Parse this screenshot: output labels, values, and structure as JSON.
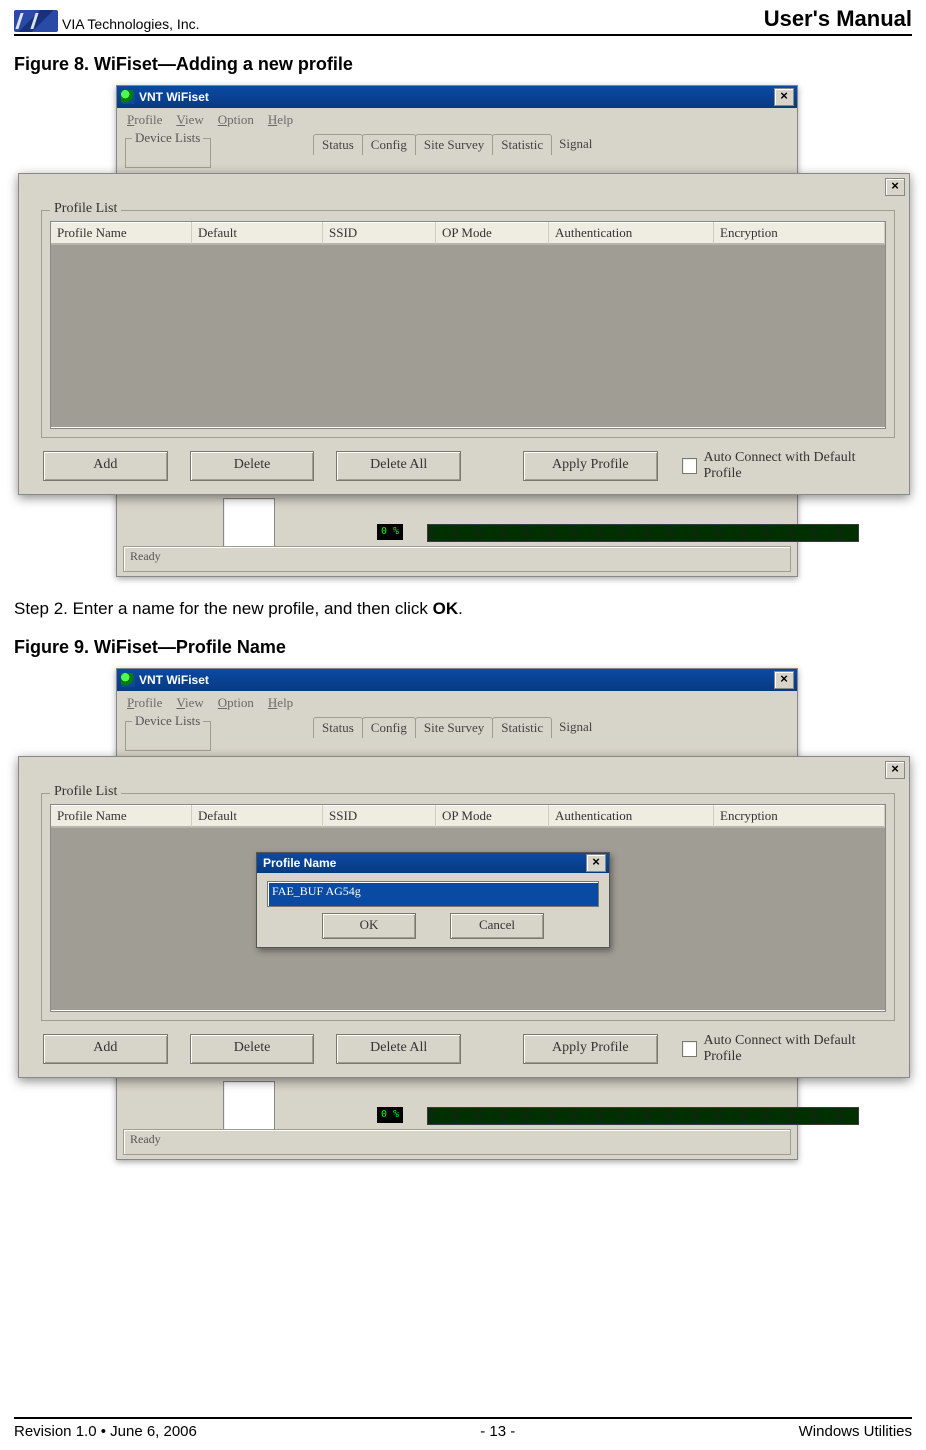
{
  "header": {
    "company": "VIA Technologies, Inc.",
    "manual": "User's Manual"
  },
  "figure8": {
    "title": "Figure 8. WiFiset—Adding a new profile"
  },
  "figure9": {
    "title": "Figure 9. WiFiset—Profile Name"
  },
  "step2": {
    "prefix": "Step 2. Enter a name for the new profile, and then click ",
    "bold": "OK",
    "suffix": "."
  },
  "win": {
    "title": "VNT WiFiset",
    "menu": {
      "profile": "Profile",
      "view": "View",
      "option": "Option",
      "help": "Help"
    },
    "device_lists": "Device Lists",
    "tabs": {
      "status": "Status",
      "config": "Config",
      "site": "Site Survey",
      "stat": "Statistic",
      "signal": "Signal"
    },
    "signal_pct": "0 %",
    "status_text": "Ready"
  },
  "profile": {
    "group": "Profile List",
    "cols": {
      "name": "Profile Name",
      "default": "Default",
      "ssid": "SSID",
      "op": "OP Mode",
      "auth": "Authentication",
      "enc": "Encryption"
    },
    "buttons": {
      "add": "Add",
      "delete": "Delete",
      "delete_all": "Delete All",
      "apply": "Apply Profile"
    },
    "checkbox": "Auto Connect with Default Profile"
  },
  "popup": {
    "title": "Profile Name",
    "value": "FAE_BUF AG54g",
    "ok": "OK",
    "cancel": "Cancel"
  },
  "footer": {
    "left": "Revision 1.0 • June 6, 2006",
    "center": "- 13 -",
    "right": "Windows Utilities"
  }
}
